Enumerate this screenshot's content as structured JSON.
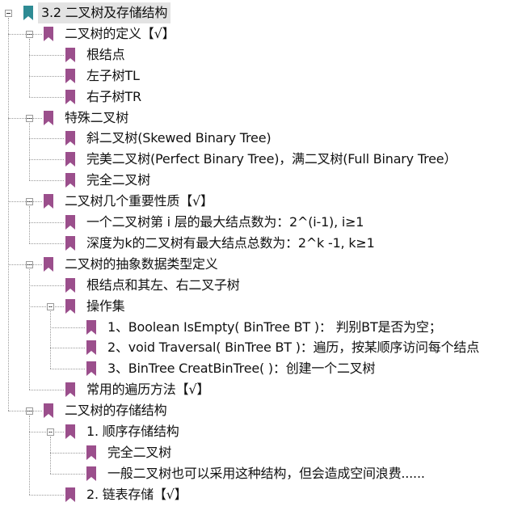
{
  "tree": {
    "root": "3.2 二叉树及存储结构",
    "items": [
      {
        "label": "二叉树的定义【√】",
        "level": 1,
        "expanded": true
      },
      {
        "label": "根结点",
        "level": 2
      },
      {
        "label": "左子树TL",
        "level": 2
      },
      {
        "label": "右子树TR",
        "level": 2
      },
      {
        "label": "特殊二叉树",
        "level": 1,
        "expanded": true
      },
      {
        "label": "斜二叉树(Skewed Binary Tree)",
        "level": 2
      },
      {
        "label": "完美二叉树(Perfect Binary Tree)，满二叉树(Full Binary Tree）",
        "level": 2
      },
      {
        "label": "完全二叉树",
        "level": 2
      },
      {
        "label": "二叉树几个重要性质【√】",
        "level": 1,
        "expanded": true
      },
      {
        "label": "一个二叉树第 i 层的最大结点数为：2^(i-1),  i≥1",
        "level": 2
      },
      {
        "label": "深度为k的二叉树有最大结点总数为：2^k -1,  k≥1",
        "level": 2
      },
      {
        "label": "二叉树的抽象数据类型定义",
        "level": 1,
        "expanded": true
      },
      {
        "label": "根结点和其左、右二叉子树",
        "level": 2
      },
      {
        "label": "操作集",
        "level": 2,
        "expanded": true
      },
      {
        "label": "1、Boolean IsEmpty( BinTree BT )：  判别BT是否为空；",
        "level": 3
      },
      {
        "label": "2、void Traversal( BinTree BT )：遍历，按某顺序访问每个结点",
        "level": 3
      },
      {
        "label": "3、BinTree CreatBinTree( )：创建一个二叉树",
        "level": 3
      },
      {
        "label": "常用的遍历方法【√】",
        "level": 2
      },
      {
        "label": "二叉树的存储结构",
        "level": 1,
        "expanded": true
      },
      {
        "label": "1. 顺序存储结构",
        "level": 2,
        "expanded": true
      },
      {
        "label": "完全二叉树",
        "level": 3
      },
      {
        "label": "一般二叉树也可以采用这种结构，但会造成空间浪费......",
        "level": 3
      },
      {
        "label": "2. 链表存储【√】",
        "level": 2
      }
    ]
  },
  "colors": {
    "root_flag": "#2e8b94",
    "node_flag": "#9b4f8c",
    "root_highlight": "#e3e3e3",
    "connector": "#9a9a9a"
  },
  "icons": {
    "root_flag": "teal-bookmark-icon",
    "node_flag": "purple-bookmark-icon",
    "toggle": "collapse-minus-icon"
  }
}
